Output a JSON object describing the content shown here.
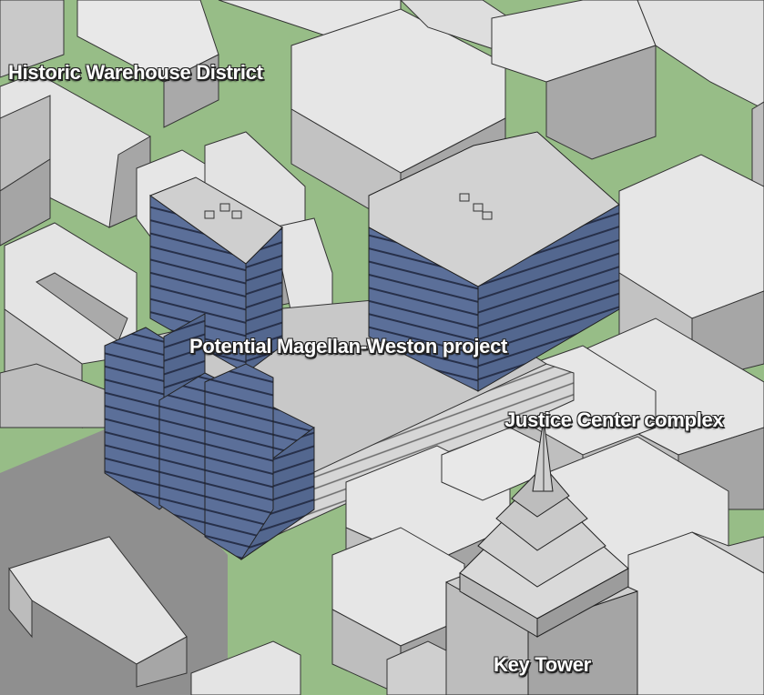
{
  "labels": {
    "historic": "Historic Warehouse District",
    "project": "Potential Magellan-Weston project",
    "justice": "Justice Center complex",
    "key_tower": "Key Tower"
  },
  "colors": {
    "ground": "#97bd87",
    "building_top": "#e6e6e6",
    "building_left": "#bcbcbc",
    "building_right": "#a3a3a3",
    "proposed_facade": "#5a6e98",
    "proposed_floor_line": "#2c3550",
    "podium_roof": "#c9c9c9",
    "podium_stripe": "#e2e2e2"
  }
}
